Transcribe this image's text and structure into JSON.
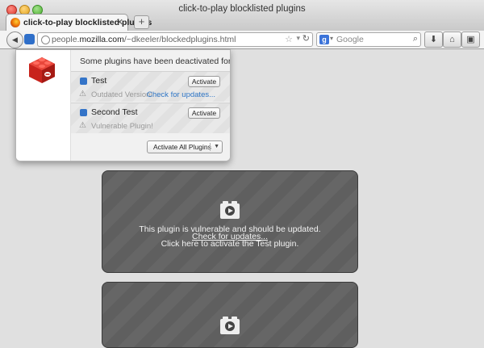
{
  "window": {
    "title": "click-to-play blocklisted plugins"
  },
  "tabs": [
    {
      "label": "click-to-play blocklisted plugins",
      "close_glyph": "✕"
    }
  ],
  "toolbar": {
    "new_tab_glyph": "+",
    "back_glyph": "◀",
    "url": {
      "domain_before": "people.",
      "domain_main": "mozilla.com",
      "path": "/~dkeeler/blockedplugins.html"
    },
    "search": {
      "engine_glyph": "g",
      "placeholder": "Google"
    },
    "icons": [
      "back-icon",
      "identity-icon",
      "globe-icon",
      "star-icon",
      "dropdown-icon",
      "reload-icon",
      "google-icon",
      "search-icon",
      "download-icon",
      "home-icon",
      "screenshot-icon"
    ]
  },
  "popup": {
    "header": "Some plugins have been deactivated for your safety.",
    "plugins": [
      {
        "name": "Test",
        "warning": "Outdated Version!",
        "link": "Check for updates...",
        "button": "Activate"
      },
      {
        "name": "Second Test",
        "warning": "Vulnerable Plugin!",
        "button": "Activate"
      }
    ],
    "activate_all": "Activate All Plugins",
    "accent_color": "#d02a22"
  },
  "main": {
    "plugin_placeholders": [
      {
        "line1": "This plugin is vulnerable and should be updated.",
        "line2": "Check for updates...",
        "line3": "Click here to activate the Test plugin."
      }
    ]
  }
}
